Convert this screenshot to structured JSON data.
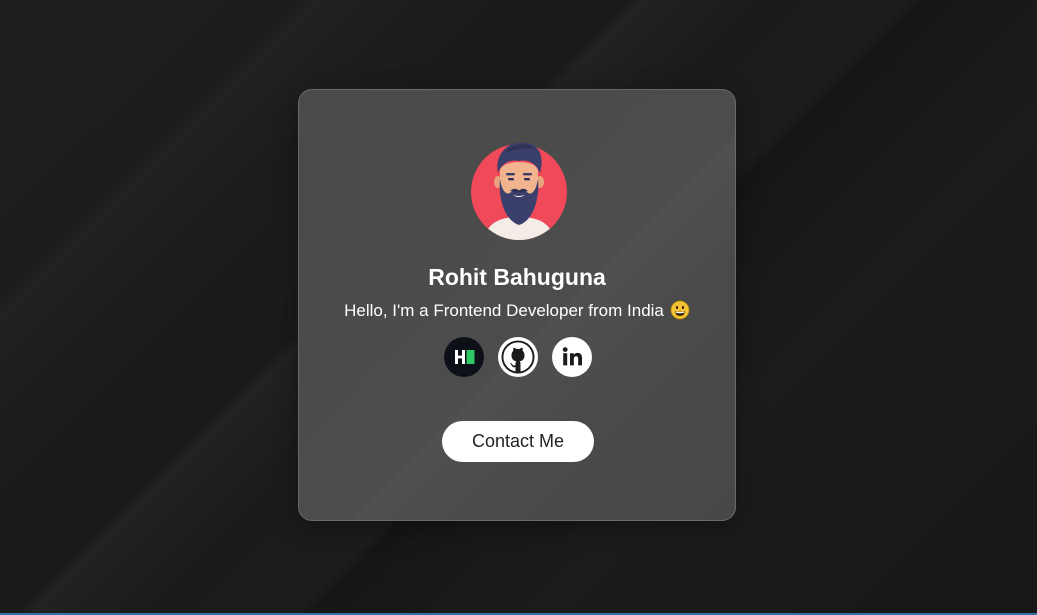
{
  "profile": {
    "name": "Rohit Bahuguna",
    "tagline": "Hello, I'm a Frontend Developer from India",
    "avatar_icon": "bearded-man-avatar-icon",
    "tagline_emoji": "grinning-face-emoji"
  },
  "socials": [
    {
      "icon": "hackerrank-icon"
    },
    {
      "icon": "github-icon"
    },
    {
      "icon": "linkedin-icon"
    }
  ],
  "actions": {
    "contact_label": "Contact Me"
  },
  "colors": {
    "background": "#1c1c1c",
    "card": "#4a4a4a",
    "card_border": "#6a6a6a",
    "avatar_bg": "#f04a5a",
    "hackerrank_green": "#2ec866",
    "button_bg": "#ffffff",
    "text": "#ffffff"
  }
}
